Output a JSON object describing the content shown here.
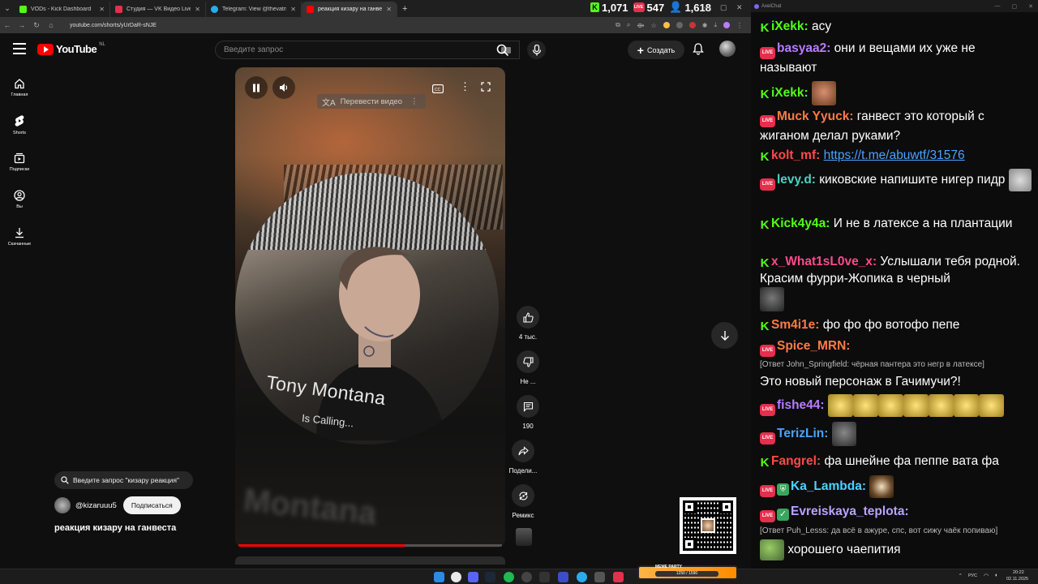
{
  "browser": {
    "tabs": [
      {
        "title": "VODs - Kick Dashboard",
        "color": "#53fc18"
      },
      {
        "title": "Студия — VK Видео Live",
        "color": "#e62e4d"
      },
      {
        "title": "Telegram: View @thevatnick",
        "color": "#2aabee"
      },
      {
        "title": "реакция кизару на ганвеста",
        "color": "#ff0000"
      }
    ],
    "url": "youtube.com/shorts/yUrDaR-sNJE"
  },
  "stats": {
    "kick": "1,071",
    "vk": "547",
    "viewers": "1,618"
  },
  "youtube": {
    "logo_text": "YouTube",
    "region": "NL",
    "search_placeholder": "Введите запрос",
    "create_label": "Создать",
    "sidebar": [
      {
        "label": "Главная",
        "icon": "home-icon"
      },
      {
        "label": "Shorts",
        "icon": "shorts-icon"
      },
      {
        "label": "Подписки",
        "icon": "subscriptions-icon"
      },
      {
        "label": "Вы",
        "icon": "you-icon"
      },
      {
        "label": "Скачанные",
        "icon": "download-icon"
      }
    ],
    "video": {
      "translate_label": "Перевести видео",
      "shirt_text": "Tony Montana",
      "shirt_sub": "Is Calling...",
      "progress": 0.63
    },
    "actions": {
      "likes": "4 тыс.",
      "dislike": "Не ...",
      "comments": "190",
      "share": "Подели...",
      "remix": "Ремикс"
    },
    "search_pill": "Введите запрос \"кизару реакция\"",
    "channel": "@kizaruuu5",
    "subscribe_label": "Подписаться",
    "short_title": "реакция кизару на ганвеста"
  },
  "chat": {
    "window_title": "AxelChat",
    "messages": [
      {
        "platform": "kick",
        "nick": "iXekk",
        "color": "#53fc18",
        "text": "асу"
      },
      {
        "platform": "vk",
        "nick": "basyaa2",
        "color": "#b87cff",
        "text": "они и вещами их уже не называют"
      },
      {
        "platform": "kick",
        "nick": "iXekk",
        "color": "#53fc18",
        "text": ""
      },
      {
        "platform": "vk",
        "nick": "Muck Yyuck",
        "color": "#ff7a45",
        "text": "ганвест это который с жиганом делал руками?"
      },
      {
        "platform": "kick",
        "nick": "kolt_mf",
        "color": "#ff4a4a",
        "text": "https://t.me/abuwtf/31576"
      },
      {
        "platform": "vk",
        "nick": "levy.d",
        "color": "#4ad3c4",
        "text": "киковские напишите нигер пидр"
      },
      {
        "platform": "kick",
        "nick": "Kick4y4a",
        "color": "#53fc18",
        "text": "И не в латексе а на плантации"
      },
      {
        "platform": "kick",
        "nick": "x_What1sL0ve_x",
        "color": "#ff4a8a",
        "text": "Услышали тебя родной. Красим фурри-Жопика в черный"
      },
      {
        "platform": "kick",
        "nick": "Sm4i1e",
        "color": "#ff7a45",
        "text": "фо фо фо вотофо пепе"
      },
      {
        "platform": "vk",
        "nick": "Spice_MRN",
        "color": "#ff7a45",
        "reply": "[Ответ John_Springfield: чёрная пантера это негр в латексе]",
        "text": "Это новый персонаж в Гачимучи?!"
      },
      {
        "platform": "vk",
        "nick": "fishe44",
        "color": "#b87cff",
        "text": ""
      },
      {
        "platform": "vk",
        "nick": "TerizLin",
        "color": "#4aa3ff",
        "text": ""
      },
      {
        "platform": "kick",
        "nick": "Fangrel",
        "color": "#ff4a4a",
        "text": "фа шнейне фа пеппе вата фа"
      },
      {
        "platform": "vk",
        "nick": "Ka_Lambda",
        "color": "#4ad3ff",
        "text": ""
      },
      {
        "platform": "vk",
        "nick": "Evreiskaya_teplota",
        "color": "#b8a4ff",
        "reply": "[Ответ Puh_Lesss: да всё в ажуре, спс, вот сижу чаёк попиваю]",
        "text": ""
      },
      {
        "platform": "vk",
        "nick": "",
        "color": "#ffffff",
        "text": "хорошего чаепития"
      }
    ]
  },
  "taskbar": {
    "lang": "РУС",
    "time": "20:22",
    "date": "02.11.2025",
    "meme_title": "MEME PARTY",
    "meme_progress": "1250 / 1590"
  }
}
